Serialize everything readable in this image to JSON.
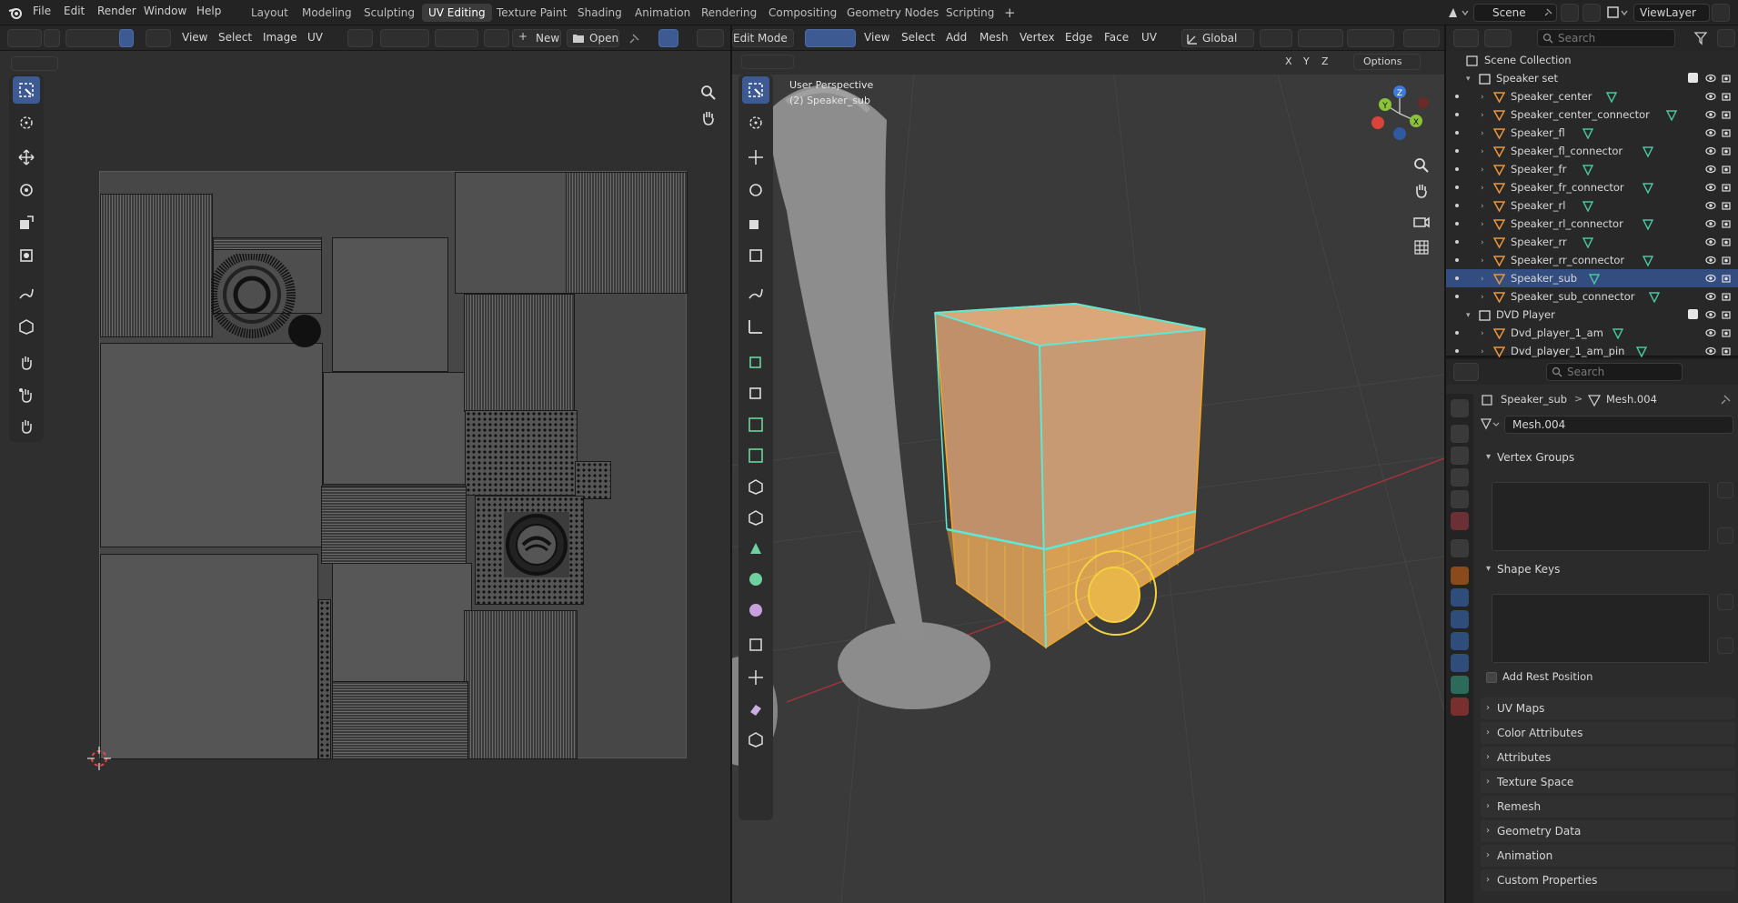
{
  "topbar": {
    "menus": [
      "File",
      "Edit",
      "Render",
      "Window",
      "Help"
    ],
    "workspaces": [
      "Layout",
      "Modeling",
      "Sculpting",
      "UV Editing",
      "Texture Paint",
      "Shading",
      "Animation",
      "Rendering",
      "Compositing",
      "Geometry Nodes",
      "Scripting"
    ],
    "active_workspace": "UV Editing",
    "add_tab": "+",
    "scene": "Scene",
    "view_layer": "ViewLayer"
  },
  "uv_editor": {
    "menus": [
      "View",
      "Select",
      "Image",
      "UV"
    ],
    "new_label": "New",
    "open_label": "Open",
    "new_plus": "+"
  },
  "viewport": {
    "mode": "Edit Mode",
    "menus": [
      "View",
      "Select",
      "Add",
      "Mesh",
      "Vertex",
      "Edge",
      "Face",
      "UV"
    ],
    "orientation": "Global",
    "options_label": "Options",
    "axes": [
      "X",
      "Y",
      "Z"
    ],
    "perspective": "User Perspective",
    "active_object": "(2) Speaker_sub",
    "gizmo": {
      "x": "X",
      "y": "Y",
      "z": "Z"
    }
  },
  "outliner": {
    "search_placeholder": "Search",
    "root": "Scene Collection",
    "rows": [
      {
        "name": "Speaker set",
        "type": "collection",
        "selected": false
      },
      {
        "name": "Speaker_center",
        "type": "object",
        "selected": false
      },
      {
        "name": "Speaker_center_connector",
        "type": "object",
        "selected": false
      },
      {
        "name": "Speaker_fl",
        "type": "object",
        "selected": false
      },
      {
        "name": "Speaker_fl_connector",
        "type": "object",
        "selected": false
      },
      {
        "name": "Speaker_fr",
        "type": "object",
        "selected": false
      },
      {
        "name": "Speaker_fr_connector",
        "type": "object",
        "selected": false
      },
      {
        "name": "Speaker_rl",
        "type": "object",
        "selected": false
      },
      {
        "name": "Speaker_rl_connector",
        "type": "object",
        "selected": false
      },
      {
        "name": "Speaker_rr",
        "type": "object",
        "selected": false
      },
      {
        "name": "Speaker_rr_connector",
        "type": "object",
        "selected": false
      },
      {
        "name": "Speaker_sub",
        "type": "object",
        "selected": true
      },
      {
        "name": "Speaker_sub_connector",
        "type": "object",
        "selected": false
      },
      {
        "name": "DVD Player",
        "type": "collection",
        "selected": false
      },
      {
        "name": "Dvd_player_1_am",
        "type": "object",
        "selected": false
      },
      {
        "name": "Dvd_player_1_am_pin",
        "type": "object",
        "selected": false
      }
    ]
  },
  "properties": {
    "search_placeholder": "Search",
    "breadcrumb_object": "Speaker_sub",
    "breadcrumb_sep": ">",
    "breadcrumb_mesh": "Mesh.004",
    "mesh_name": "Mesh.004",
    "panels": {
      "vertex_groups": "Vertex Groups",
      "shape_keys": "Shape Keys",
      "add_rest_position": "Add Rest Position",
      "uv_maps": "UV Maps",
      "color_attributes": "Color Attributes",
      "attributes": "Attributes",
      "texture_space": "Texture Space",
      "remesh": "Remesh",
      "geometry_data": "Geometry Data",
      "animation": "Animation",
      "custom_properties": "Custom Properties"
    }
  },
  "colors": {
    "accent": "#3d5a93",
    "selected_row": "#334d80",
    "edit_orange": "#f5a623",
    "active_edge": "#5ee8d5",
    "mesh_green": "#49c6a0",
    "object_orange": "#e8963c"
  }
}
